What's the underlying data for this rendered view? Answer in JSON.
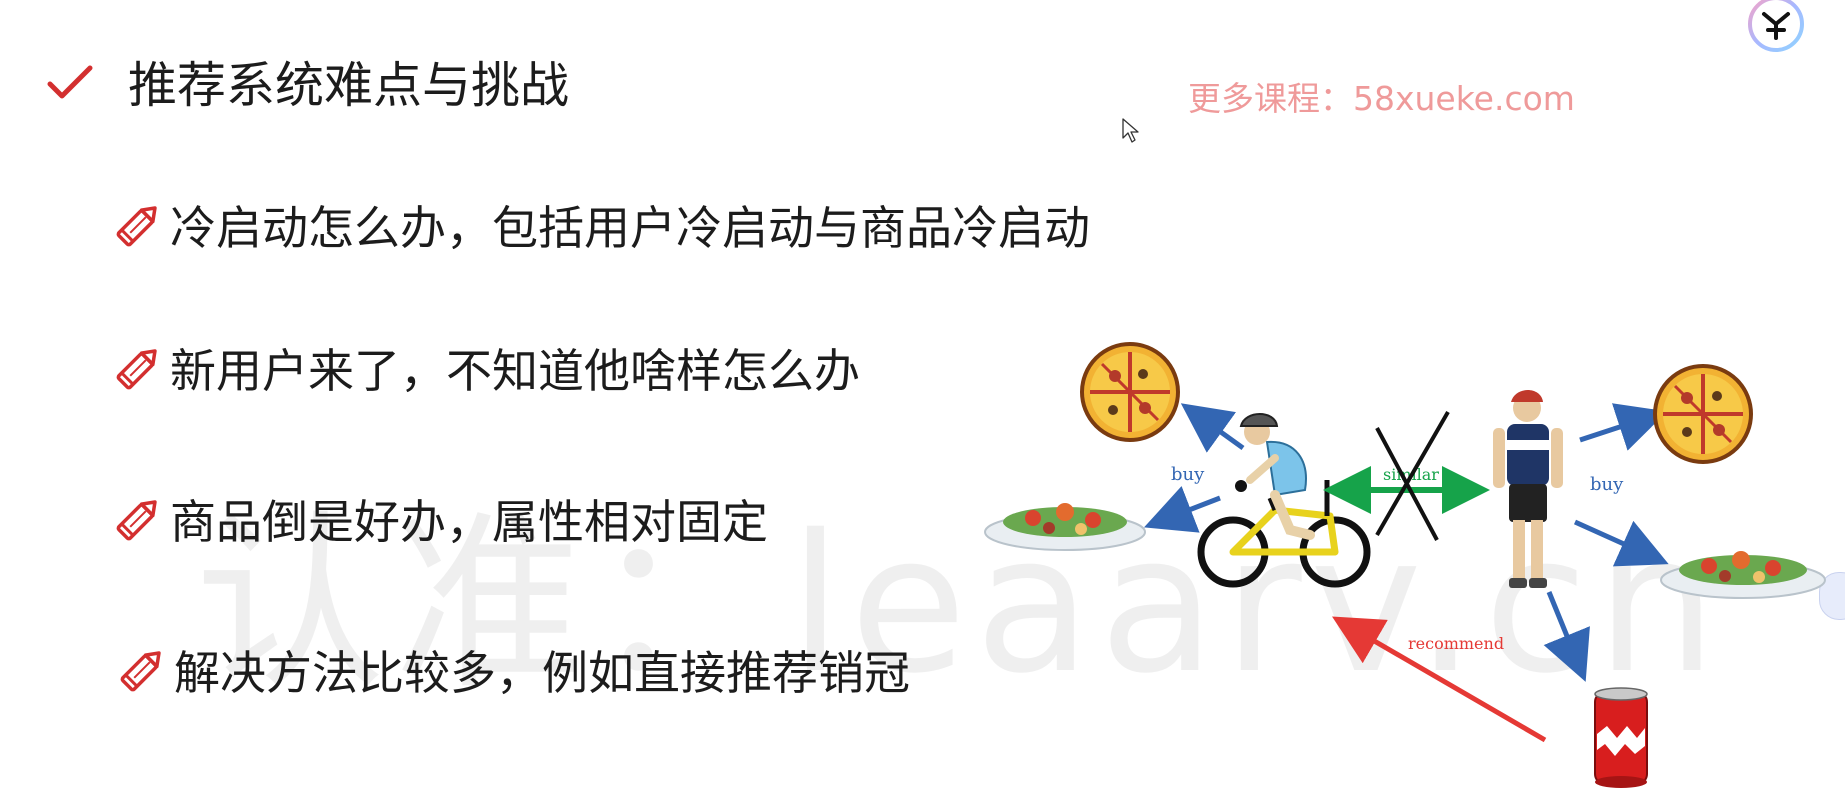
{
  "watermarks": {
    "center": "认准：leaarv.cn",
    "top": "更多课程：58xueke.com"
  },
  "slide": {
    "title": "推荐系统难点与挑战",
    "bullets": [
      {
        "text": "冷启动怎么办，包括用户冷启动与商品冷启动"
      },
      {
        "text": "新用户来了，不知道他啥样怎么办"
      },
      {
        "text": "商品倒是好办，属性相对固定"
      },
      {
        "text": "解决方法比较多，例如直接推荐销冠"
      }
    ]
  },
  "diagram": {
    "label_buy_left": "buy",
    "label_similar": "similar",
    "label_buy_right": "buy",
    "label_recommend": "recommend"
  },
  "colors": {
    "accent_red": "#d32f2f",
    "arrow_blue": "#3366b3",
    "arrow_green": "#16a34a",
    "arrow_red": "#e53935",
    "watermark_pink": "#ef9a9a"
  },
  "icons": {
    "title": "check-icon",
    "bullet": "pencil-icon",
    "top_right": "logo-badge-icon"
  }
}
